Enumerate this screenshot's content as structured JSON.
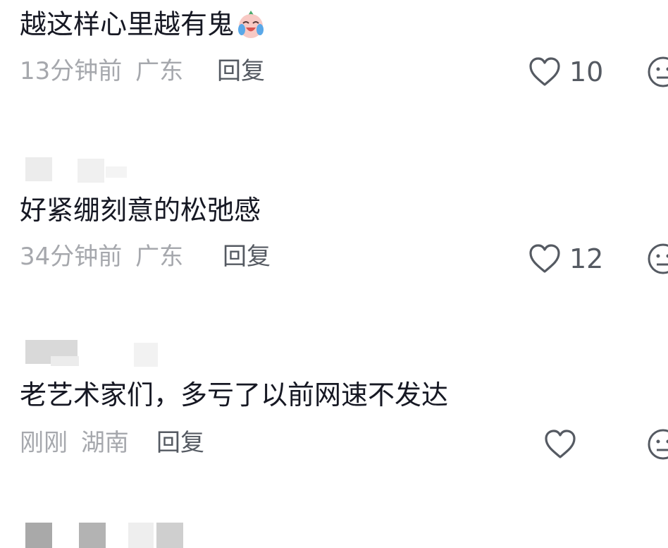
{
  "comments": [
    {
      "text": "越这样心里越有鬼",
      "emoji": "crying-laughing-face-emoji",
      "time": "13分钟前",
      "location": "广东",
      "reply_label": "回复",
      "likes": "10"
    },
    {
      "text": "好紧绷刻意的松弛感",
      "time": "34分钟前",
      "location": "广东",
      "reply_label": "回复",
      "likes": "12"
    },
    {
      "text": "老艺术家们，多亏了以前网速不发达",
      "time": "刚刚",
      "location": "湖南",
      "reply_label": "回复",
      "likes": ""
    }
  ],
  "icons": {
    "like": "heart-outline-icon",
    "dislike": "dislike-face-icon"
  },
  "colors": {
    "text": "#161823",
    "meta": "#a6a8ad",
    "action": "#555a62",
    "redacted": "#d6d6d6"
  }
}
